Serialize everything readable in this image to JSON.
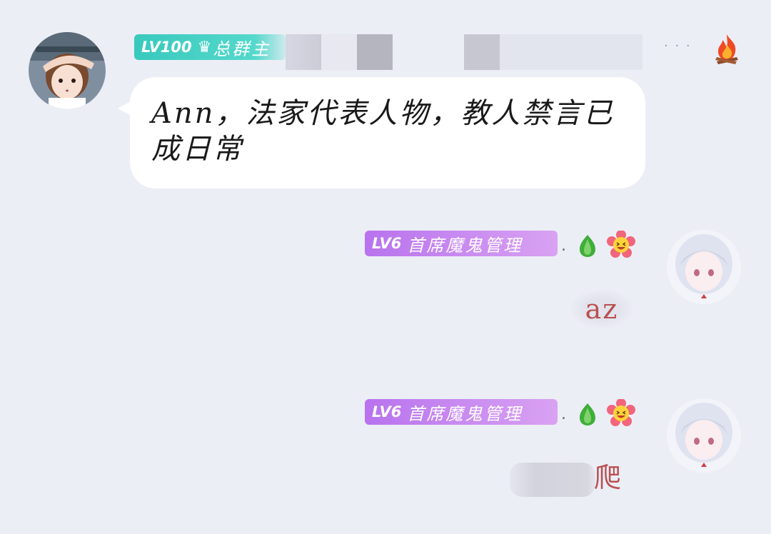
{
  "message_1": {
    "badge_level": "LV100",
    "badge_title": "总群主",
    "text": "Ann，法家代表人物，教人禁言已成日常"
  },
  "message_2": {
    "badge_level": "LV6",
    "badge_title": "首席魔鬼管理",
    "separator": ".",
    "text": "az"
  },
  "message_3": {
    "badge_level": "LV6",
    "badge_title": "首席魔鬼管理",
    "separator": ".",
    "text": "爬"
  },
  "menu_dots": "· · ·",
  "icons": {
    "owner_badge": "crown-icon",
    "top_right": "fire-icon",
    "title_badges": [
      "sprout-icon",
      "flower-smile-icon"
    ]
  },
  "colors": {
    "background": "#eceef6",
    "owner_badge": "#38c9bd",
    "admin_badge": "#c184ef",
    "short_msg_text": "#b95050"
  }
}
